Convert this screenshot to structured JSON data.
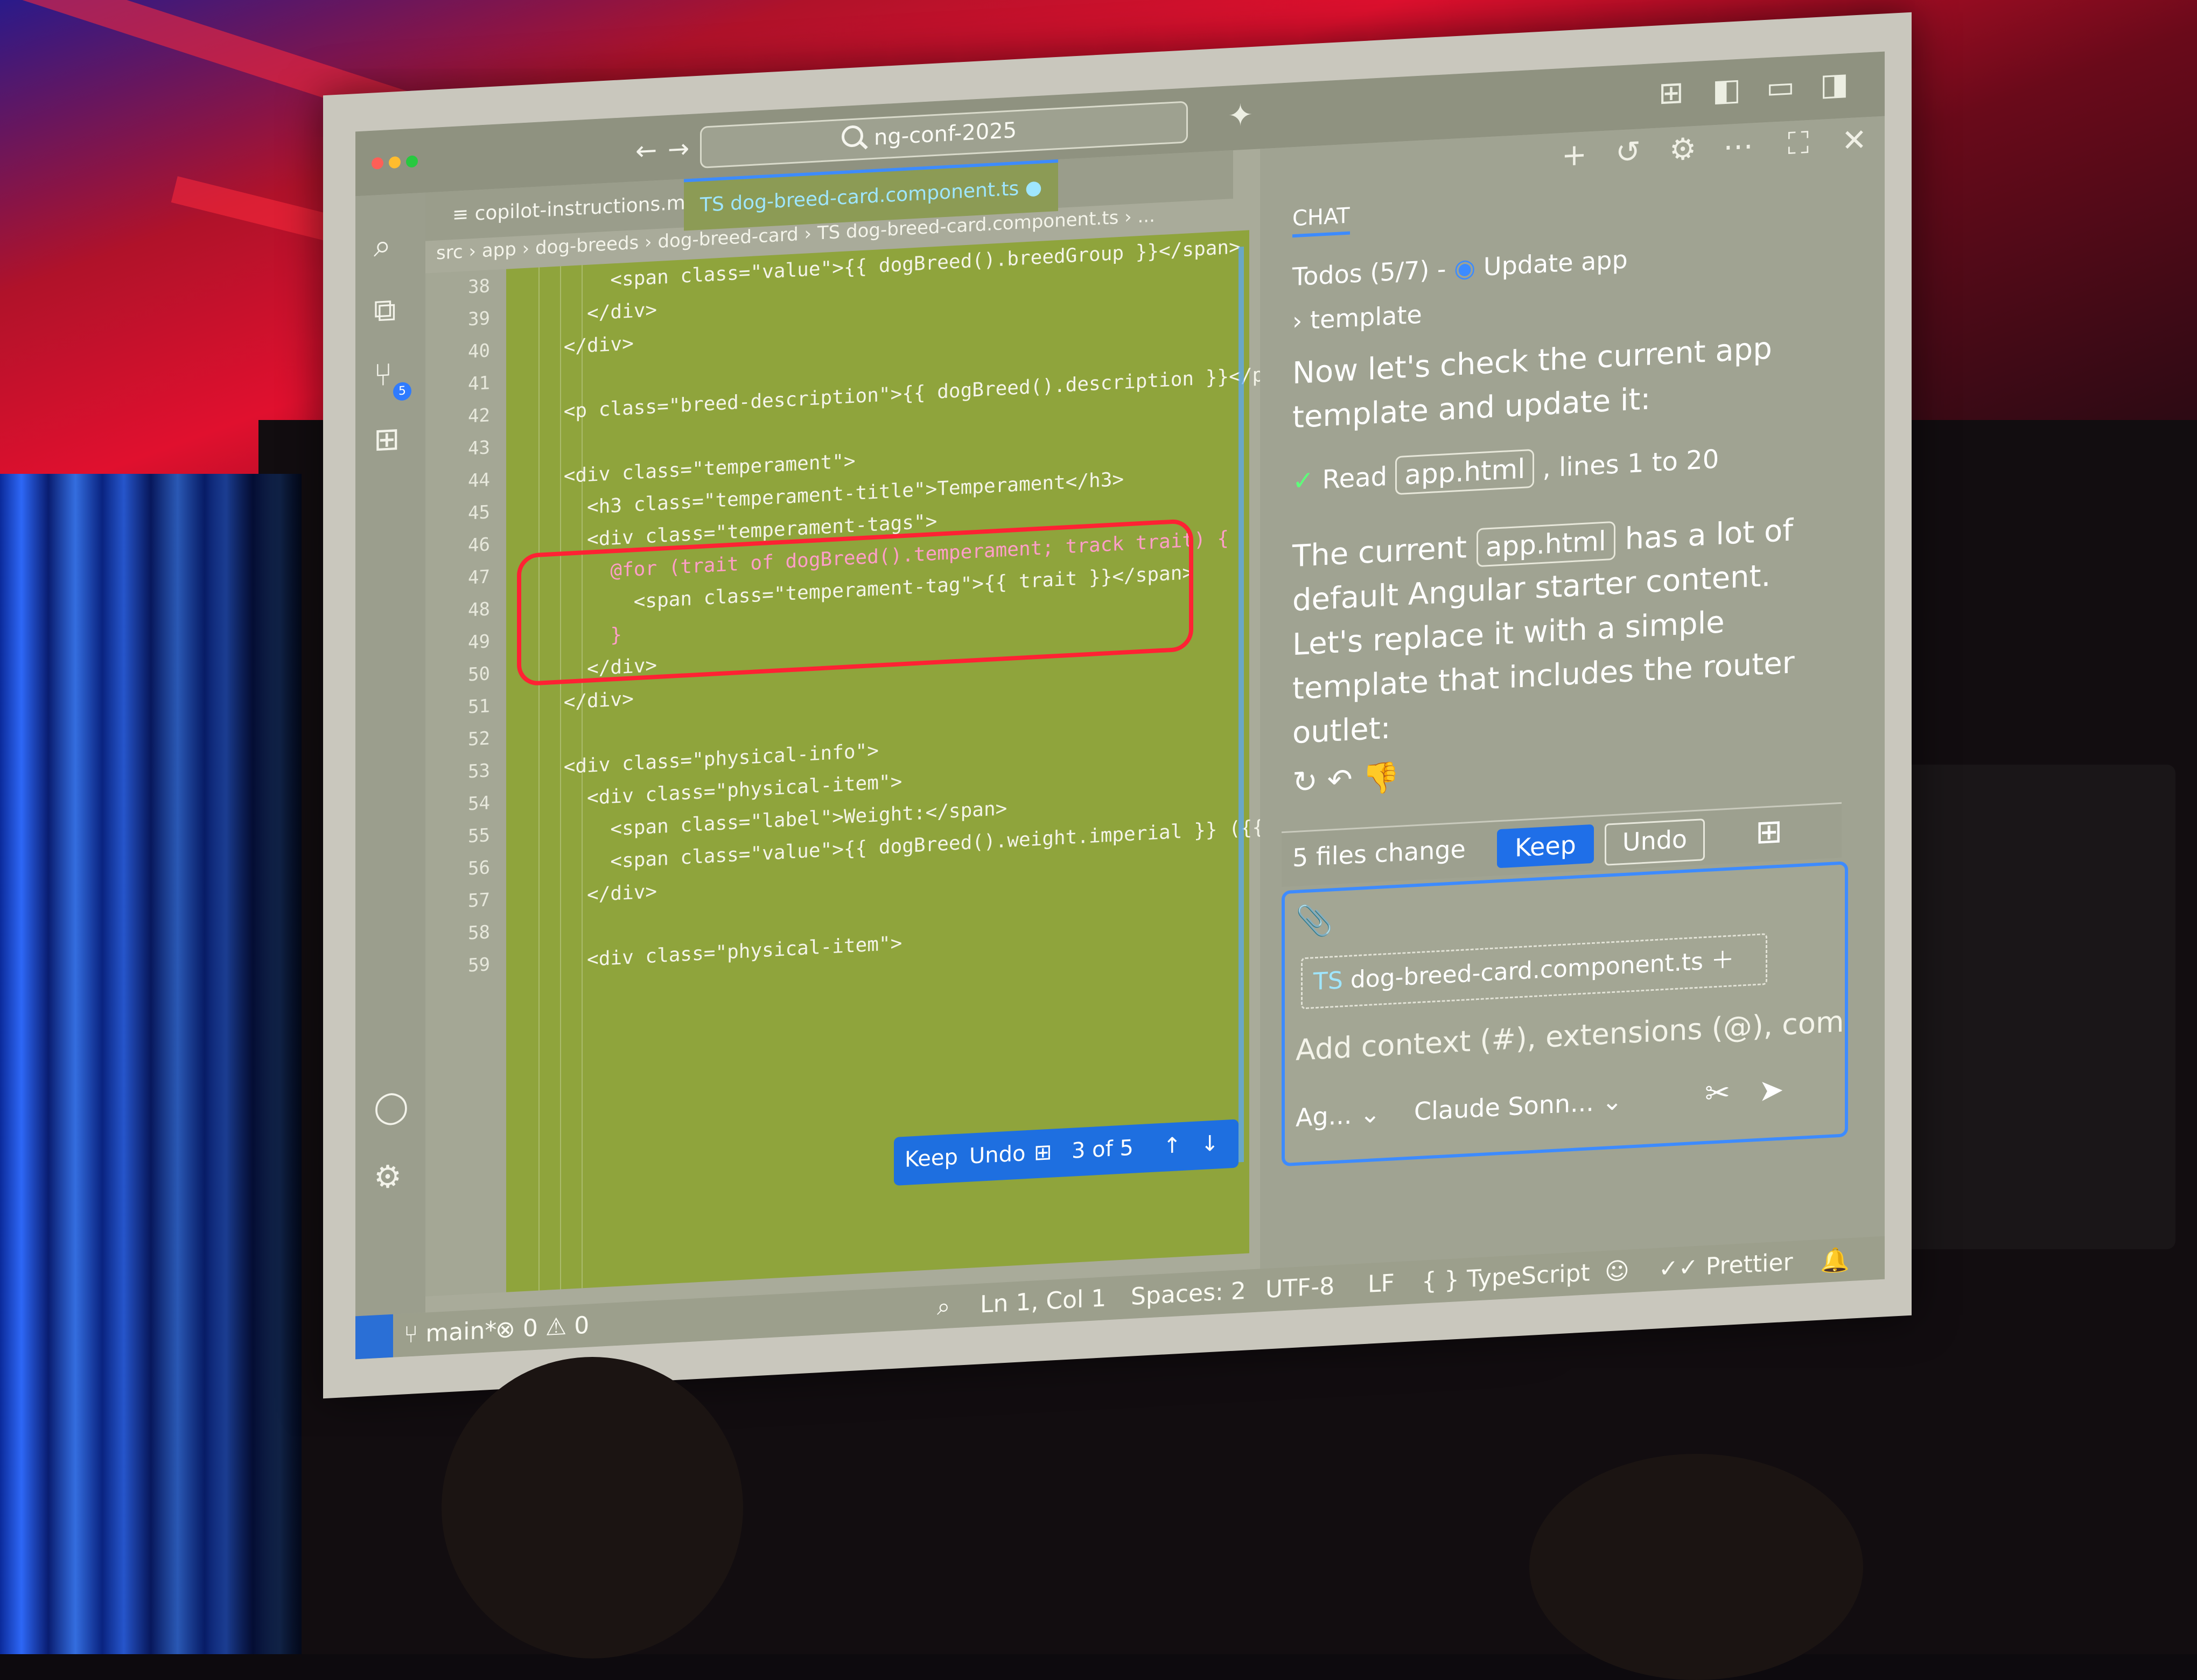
{
  "editor": {
    "window_title": "ng-conf-2025",
    "tabs": [
      {
        "label": "≡ copilot-instructions.md"
      },
      {
        "label": "TS dog-breed-card.component.ts ●",
        "active": true
      }
    ],
    "breadcrumb": "src › app › dog-breeds › dog-breed-card › TS dog-breed-card.component.ts › ...",
    "line_numbers": [
      "38",
      "39",
      "40",
      "41",
      "42",
      "43",
      "44",
      "45",
      "46",
      "47",
      "48",
      "49",
      "50",
      "51",
      "52",
      "53",
      "54",
      "55",
      "56",
      "57",
      "58",
      "59"
    ],
    "code_lines": [
      "        <span class=\"value\">{{ dogBreed().breedGroup }}</span>",
      "      </div>",
      "    </div>",
      "",
      "    <p class=\"breed-description\">{{ dogBreed().description }}</p>",
      "",
      "    <div class=\"temperament\">",
      "      <h3 class=\"temperament-title\">Temperament</h3>",
      "      <div class=\"temperament-tags\">",
      "        @for (trait of dogBreed().temperament; track trait) {",
      "          <span class=\"temperament-tag\">{{ trait }}</span>",
      "        }",
      "      </div>",
      "    </div>",
      "",
      "    <div class=\"physical-info\">",
      "      <div class=\"physical-item\">",
      "        <span class=\"label\">Weight:</span>",
      "        <span class=\"value\">{{ dogBreed().weight.imperial }} ({{ dogBre",
      "      </div>",
      "",
      "      <div class=\"physical-item\">"
    ],
    "inline_review": {
      "keep": "Keep",
      "undo": "Undo",
      "position": "3 of 5"
    }
  },
  "chat": {
    "tab_label": "CHAT",
    "todos": "Todos (5/7) -",
    "todo_current": "Update app",
    "todo_current_cont": "template",
    "message_1": "Now let's check the current app template and update it:",
    "read_label": "Read",
    "read_file": "app.html",
    "read_range": ", lines 1 to 20",
    "message_2_prefix": "The current",
    "message_2_file": "app.html",
    "message_2_suffix": "has a lot of default Angular starter content. Let's replace it with a simple template that includes the router outlet:",
    "files_changed": "5 files change",
    "keep": "Keep",
    "undo": "Undo",
    "attached_file": "dog-breed-card.component.ts",
    "input_placeholder": "Add context (#), extensions (@), com",
    "agent_mode": "Ag...",
    "model": "Claude Sonn..."
  },
  "statusbar": {
    "branch": "main*",
    "problems": "⊗ 0 ⚠ 0",
    "position": "Ln 1, Col 1",
    "spaces": "Spaces: 2",
    "encoding": "UTF-8",
    "eol": "LF",
    "language": "{ } TypeScript",
    "formatter": "✓✓ Prettier"
  },
  "colors": {
    "accent": "#3d8bff",
    "highlight_border": "#ff2233",
    "editor_bg": "#8fa43c"
  }
}
